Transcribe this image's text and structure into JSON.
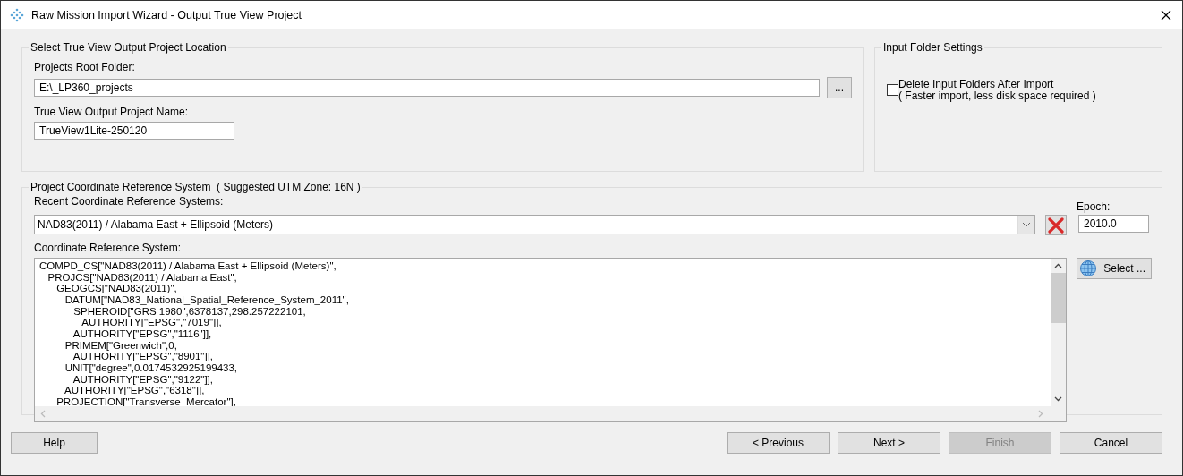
{
  "window": {
    "title": "Raw Mission Import Wizard - Output True View Project"
  },
  "location_group": {
    "title": "Select True View Output Project Location",
    "root_folder_label": "Projects Root Folder:",
    "root_folder_value": "E:\\_LP360_projects",
    "browse_label": "...",
    "project_name_label": "True View Output Project Name:",
    "project_name_value": "TrueView1Lite-250120"
  },
  "input_folder_group": {
    "title": "Input Folder Settings",
    "delete_checkbox": {
      "checked": false,
      "label": "Delete Input Folders After Import",
      "note": "( Faster import, less disk space required )"
    }
  },
  "crs_group": {
    "title": "Project Coordinate Reference System",
    "suggestion": "( Suggested UTM Zone: 16N )",
    "recent_label": "Recent Coordinate Reference Systems:",
    "recent_value": "NAD83(2011) / Alabama East + Ellipsoid (Meters)",
    "epoch_label": "Epoch:",
    "epoch_value": "2010.0",
    "crs_label": "Coordinate Reference System:",
    "select_label": "Select ...",
    "crs_lines": [
      "COMPD_CS[\"NAD83(2011) / Alabama East + Ellipsoid (Meters)\",",
      "   PROJCS[\"NAD83(2011) / Alabama East\",",
      "      GEOGCS[\"NAD83(2011)\",",
      "         DATUM[\"NAD83_National_Spatial_Reference_System_2011\",",
      "            SPHEROID[\"GRS 1980\",6378137,298.257222101,",
      "               AUTHORITY[\"EPSG\",\"7019\"]],",
      "            AUTHORITY[\"EPSG\",\"1116\"]],",
      "         PRIMEM[\"Greenwich\",0,",
      "            AUTHORITY[\"EPSG\",\"8901\"]],",
      "         UNIT[\"degree\",0.0174532925199433,",
      "            AUTHORITY[\"EPSG\",\"9122\"]],",
      "         AUTHORITY[\"EPSG\",\"6318\"]],",
      "      PROJECTION[\"Transverse_Mercator\"],"
    ]
  },
  "buttons": [
    {
      "label": "Help",
      "disabled": false
    },
    {
      "label": "< Previous",
      "disabled": false
    },
    {
      "label": "Next >",
      "disabled": false
    },
    {
      "label": "Finish",
      "disabled": true
    },
    {
      "label": "Cancel",
      "disabled": false
    }
  ]
}
